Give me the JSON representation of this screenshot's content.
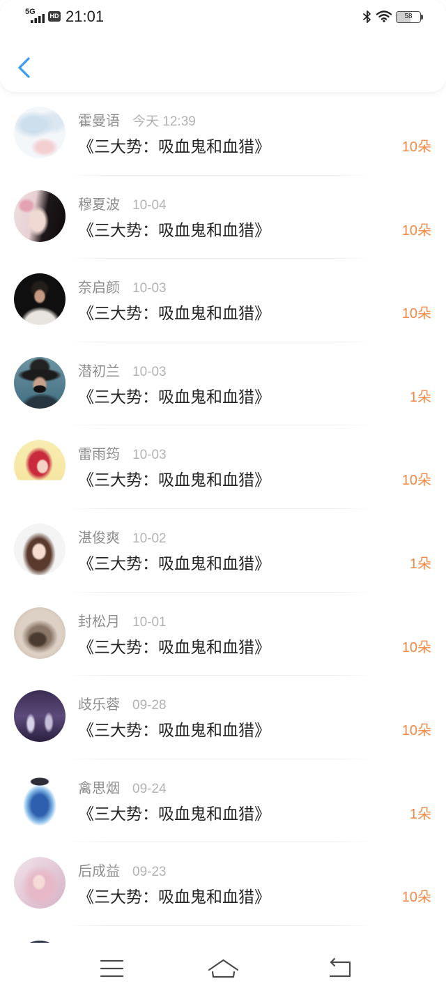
{
  "status_bar": {
    "network": "5G",
    "hd_badge": "HD",
    "time": "21:01",
    "battery_level": "58",
    "icons": [
      "signal-icon",
      "bluetooth-icon",
      "wifi-icon",
      "battery-icon"
    ]
  },
  "header": {
    "back_icon": "chevron-left-icon"
  },
  "colors": {
    "accent": "#3a9cf0",
    "count": "#f28a48",
    "name": "#8e8e8e",
    "time": "#b3b3b3",
    "title": "#262626"
  },
  "list": {
    "items": [
      {
        "name": "霍曼语",
        "time": "今天 12:39",
        "title": "《三大势：吸血鬼和血猎》",
        "count": "10朵"
      },
      {
        "name": "穆夏波",
        "time": "10-04",
        "title": "《三大势：吸血鬼和血猎》",
        "count": "10朵"
      },
      {
        "name": "奈启颜",
        "time": "10-03",
        "title": "《三大势：吸血鬼和血猎》",
        "count": "10朵"
      },
      {
        "name": "潜初兰",
        "time": "10-03",
        "title": "《三大势：吸血鬼和血猎》",
        "count": "1朵"
      },
      {
        "name": "雷雨筠",
        "time": "10-03",
        "title": "《三大势：吸血鬼和血猎》",
        "count": "10朵"
      },
      {
        "name": "湛俊爽",
        "time": "10-02",
        "title": "《三大势：吸血鬼和血猎》",
        "count": "1朵"
      },
      {
        "name": "封松月",
        "time": "10-01",
        "title": "《三大势：吸血鬼和血猎》",
        "count": "10朵"
      },
      {
        "name": "歧乐蓉",
        "time": "09-28",
        "title": "《三大势：吸血鬼和血猎》",
        "count": "10朵"
      },
      {
        "name": "禽思烟",
        "time": "09-24",
        "title": "《三大势：吸血鬼和血猎》",
        "count": "1朵"
      },
      {
        "name": "后成益",
        "time": "09-23",
        "title": "《三大势：吸血鬼和血猎》",
        "count": "10朵"
      }
    ]
  },
  "nav_bar": {
    "icons": [
      "menu-icon",
      "home-icon",
      "back-icon"
    ]
  }
}
